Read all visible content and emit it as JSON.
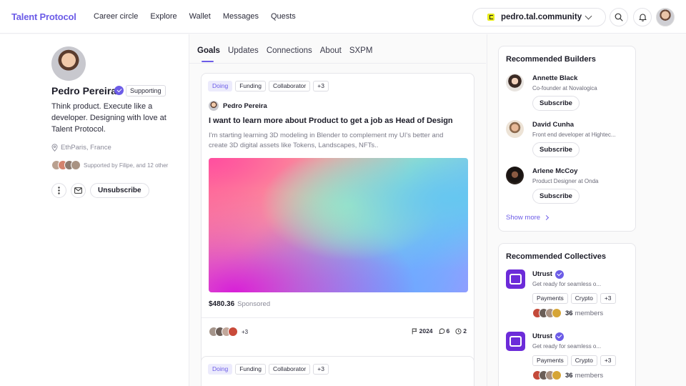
{
  "header": {
    "logo": "Talent Protocol",
    "nav": [
      "Career circle",
      "Explore",
      "Wallet",
      "Messages",
      "Quests"
    ],
    "domain": "pedro.tal.community"
  },
  "profile": {
    "name": "Pedro Pereira",
    "badge": "Supporting",
    "bio": "Think product. Execute like a developer. Designing with love at Talent Protocol.",
    "location": "EthParis, France",
    "supporters_text": "Supported by Filipe, and 12 other",
    "unsubscribe_label": "Unsubscribe"
  },
  "tabs": [
    "Goals",
    "Updates",
    "Connections",
    "About",
    "SXPM"
  ],
  "goal_card": {
    "tags": [
      "Doing",
      "Funding",
      "Collaborator",
      "+3"
    ],
    "author": "Pedro Pereira",
    "title": "I want to learn more about Product to get a job as Head of Design",
    "description": "I'm starting learning 3D modeling in Blender to complement my UI's better and create 3D digital assets like Tokens, Landscapes, NFTs..",
    "price": "$480.36",
    "sponsored": "Sponsored",
    "supporters_more": "+3",
    "year": "2024",
    "comments": "6",
    "views": "2"
  },
  "goal_card_2": {
    "tags": [
      "Doing",
      "Funding",
      "Collaborator",
      "+3"
    ]
  },
  "builders": {
    "title": "Recommended Builders",
    "items": [
      {
        "name": "Annette Black",
        "role": "Co-founder at Novalogica",
        "action": "Subscribe"
      },
      {
        "name": "David Cunha",
        "role": "Front end developer at Hightec...",
        "action": "Subscribe"
      },
      {
        "name": "Arlene McCoy",
        "role": "Product Designer at Onda",
        "action": "Subscribe"
      }
    ],
    "show_more": "Show more"
  },
  "collectives": {
    "title": "Recommended Collectives",
    "items": [
      {
        "name": "Utrust",
        "desc": "Get ready for seamless o...",
        "tags": [
          "Payments",
          "Crypto",
          "+3"
        ],
        "count": "36",
        "label": "members"
      },
      {
        "name": "Utrust",
        "desc": "Get ready for seamless o...",
        "tags": [
          "Payments",
          "Crypto",
          "+3"
        ],
        "count": "36",
        "label": "members"
      }
    ]
  },
  "colors": {
    "accent": "#6c5ce7",
    "collective_logo": "#6c2bd9"
  }
}
